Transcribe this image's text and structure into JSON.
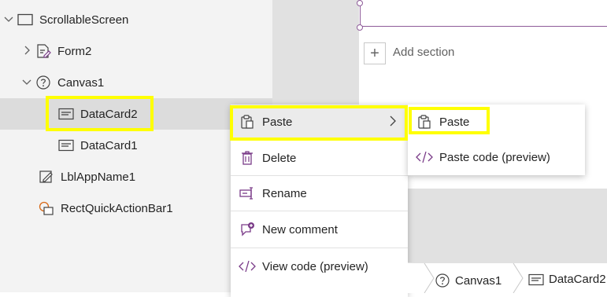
{
  "tree": {
    "items": [
      {
        "label": "ScrollableScreen"
      },
      {
        "label": "Form2"
      },
      {
        "label": "Canvas1"
      },
      {
        "label": "DataCard2"
      },
      {
        "label": "DataCard1"
      },
      {
        "label": "LblAppName1"
      },
      {
        "label": "RectQuickActionBar1"
      }
    ]
  },
  "canvas": {
    "add_section_label": "Add section"
  },
  "context_menu": {
    "items": [
      {
        "label": "Paste",
        "icon": "paste-icon"
      },
      {
        "label": "Delete",
        "icon": "trash-icon"
      },
      {
        "label": "Rename",
        "icon": "rename-icon"
      },
      {
        "label": "New comment",
        "icon": "comment-icon"
      },
      {
        "label": "View code (preview)",
        "icon": "code-icon"
      }
    ]
  },
  "submenu": {
    "items": [
      {
        "label": "Paste",
        "icon": "paste-icon"
      },
      {
        "label": "Paste code (preview)",
        "icon": "code-icon"
      }
    ]
  },
  "breadcrumb": {
    "items": [
      {
        "label": "Canvas1"
      },
      {
        "label": "DataCard2"
      }
    ]
  },
  "colors": {
    "highlight": "#ffff00",
    "accent": "#7a3b88",
    "selected_row": "#dcdcdc"
  }
}
